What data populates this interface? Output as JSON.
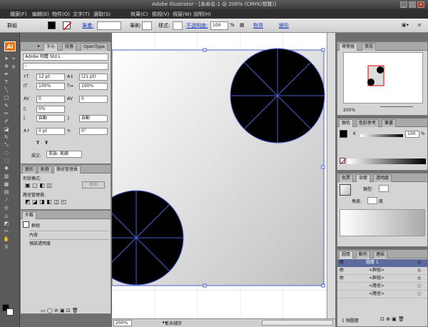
{
  "window": {
    "title": "Adobe Illustrator - [未命名-1 @ 200% (CMYK/預覽)]",
    "min": "_",
    "max": "□",
    "close": "×"
  },
  "menu": [
    "檔案(F)",
    "編輯(E)",
    "物件(O)",
    "文字(T)",
    "選取(S)",
    "效果(C)",
    "檢視(V)",
    "視窗(W)",
    "說明(H)"
  ],
  "control": {
    "selection": "群組",
    "stroke_label": "筆畫:",
    "opacity_label": "不透明度:",
    "opacity_value": "100",
    "percent": "%",
    "style_label": "樣式:",
    "align_link": "對齊",
    "transform_link": "變形",
    "brush_label": "筆刷:"
  },
  "character": {
    "tabs": [
      "字元",
      "段落",
      "OpenType"
    ],
    "font": "Adobe 明體 Std L",
    "style": "-",
    "size": "12 pt",
    "leading": "(21 pt)",
    "hscale": "100%",
    "vscale": "100%",
    "kerning": "0",
    "tracking": "0",
    "tsume": "0%",
    "aki_left": "自動",
    "aki_right": "自動",
    "baseline": "0 pt",
    "rotate": "0°",
    "lang_label": "語文:",
    "lang": "英語: 美國",
    "t1": "T",
    "t2": "Ŧ"
  },
  "pathfinder": {
    "tabs": [
      "變形",
      "對齊",
      "路徑管理員"
    ],
    "shape_modes": "形狀模式:",
    "expand": "擴展",
    "pathfinders": "路徑管理員:"
  },
  "appearance": {
    "tabs": [
      "外觀"
    ],
    "group": "群組",
    "contents": "內容",
    "default_opacity": "預設透明度"
  },
  "navigator": {
    "tabs": [
      "導覽器",
      "資訊"
    ],
    "zoom": "200%"
  },
  "color": {
    "tabs": [
      "顏色",
      "色彩參考",
      "筆畫"
    ],
    "k_label": "K",
    "k_value": "100",
    "percent": "%"
  },
  "gradient": {
    "tabs": [
      "色票",
      "漸層",
      "透明度"
    ],
    "type_label": "類型:",
    "angle_label": "角度:",
    "degree": "度"
  },
  "layers": {
    "tabs": [
      "圖層",
      "動作",
      "連結"
    ],
    "rows": [
      "圖層 1",
      "<群組>",
      "<群組>",
      "<路徑>",
      "<路徑>"
    ],
    "count": "1 個圖層"
  },
  "doc": {
    "zoom": "200%",
    "status": "從未儲存"
  },
  "colors": {
    "artboard_edge": "#4a5fd0",
    "shape": "#000000",
    "accent": "#e8710a"
  }
}
